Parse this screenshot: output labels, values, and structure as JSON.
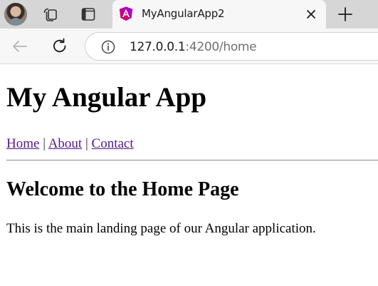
{
  "browser": {
    "tab": {
      "title": "MyAngularApp2",
      "favicon": "angular-logo-icon"
    },
    "address_bar": {
      "url_host": "127.0.0.1",
      "url_rest": ":4200/home"
    },
    "icons": {
      "profile": "avatar",
      "collections": "collections-icon",
      "tab_actions": "tab-actions-icon",
      "close_tab": "close-icon",
      "new_tab": "plus-icon",
      "back": "back-arrow-icon",
      "refresh": "refresh-icon",
      "site_info": "info-icon"
    },
    "colors": {
      "tabstrip": "#d6d6d6",
      "active_tab": "#f7f7f7",
      "angular_gradient_start": "#e40035",
      "angular_gradient_end": "#9b00ff"
    }
  },
  "page": {
    "heading": "My Angular App",
    "nav": {
      "home": "Home",
      "about": "About",
      "contact": "Contact",
      "separator": "|"
    },
    "section_title": "Welcome to the Home Page",
    "body_text": "This is the main landing page of our Angular application.",
    "colors": {
      "link": "#551a8b"
    }
  }
}
